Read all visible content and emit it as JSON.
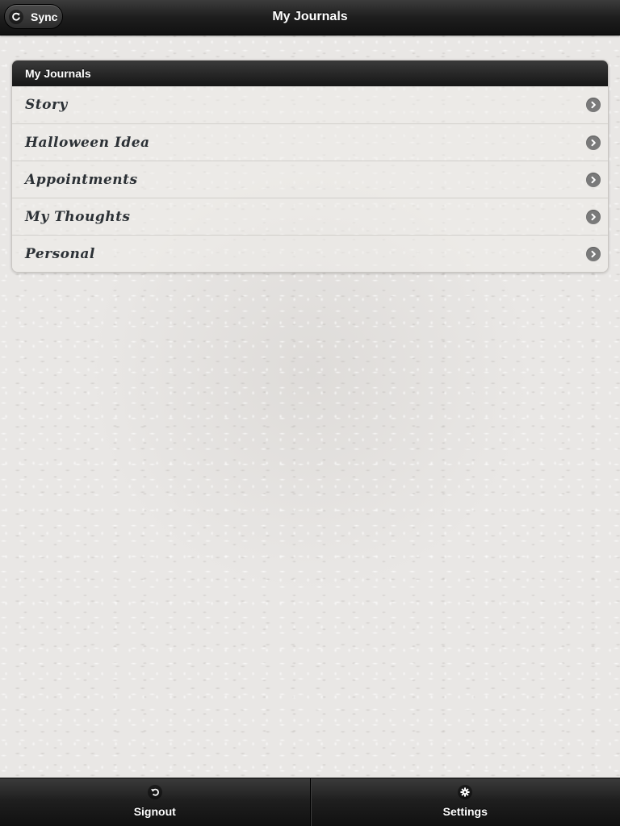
{
  "header": {
    "title": "My Journals",
    "sync_button": {
      "label": "Sync",
      "icon": "refresh-icon"
    }
  },
  "journal_list": {
    "heading": "My Journals",
    "items": [
      {
        "label": "Story",
        "icon": "chevron-right-icon"
      },
      {
        "label": "Halloween Idea",
        "icon": "chevron-right-icon"
      },
      {
        "label": "Appointments",
        "icon": "chevron-right-icon"
      },
      {
        "label": "My Thoughts",
        "icon": "chevron-right-icon"
      },
      {
        "label": "Personal",
        "icon": "chevron-right-icon"
      }
    ]
  },
  "footer": {
    "tabs": [
      {
        "label": "Signout",
        "icon": "signout-icon"
      },
      {
        "label": "Settings",
        "icon": "gear-icon"
      }
    ]
  },
  "colors": {
    "bar_dark": "#1e1e1e",
    "background": "#e9e7e5",
    "item_text": "#2c3136",
    "chevron": "#7a7a7a"
  }
}
